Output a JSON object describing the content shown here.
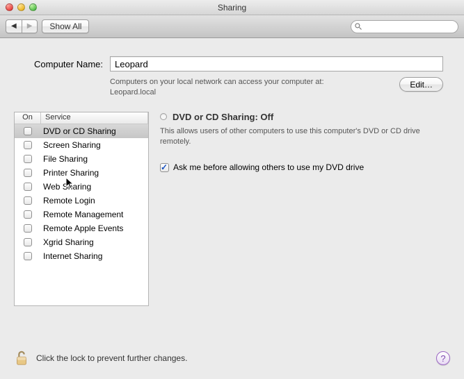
{
  "window": {
    "title": "Sharing"
  },
  "toolbar": {
    "showall_label": "Show All",
    "search_placeholder": ""
  },
  "computer_name": {
    "label": "Computer Name:",
    "value": "Leopard",
    "access_text_1": "Computers on your local network can access your computer at:",
    "access_host": "Leopard.local",
    "edit_label": "Edit…"
  },
  "services": {
    "header_on": "On",
    "header_service": "Service",
    "items": [
      {
        "name": "DVD or CD Sharing",
        "on": false,
        "selected": true
      },
      {
        "name": "Screen Sharing",
        "on": false,
        "selected": false
      },
      {
        "name": "File Sharing",
        "on": false,
        "selected": false
      },
      {
        "name": "Printer Sharing",
        "on": false,
        "selected": false
      },
      {
        "name": "Web Sharing",
        "on": false,
        "selected": false
      },
      {
        "name": "Remote Login",
        "on": false,
        "selected": false
      },
      {
        "name": "Remote Management",
        "on": false,
        "selected": false
      },
      {
        "name": "Remote Apple Events",
        "on": false,
        "selected": false
      },
      {
        "name": "Xgrid Sharing",
        "on": false,
        "selected": false
      },
      {
        "name": "Internet Sharing",
        "on": false,
        "selected": false
      }
    ]
  },
  "detail": {
    "title": "DVD or CD Sharing: Off",
    "description": "This allows users of other computers to use this computer's DVD or CD drive remotely.",
    "ask_checked": true,
    "ask_label": "Ask me before allowing others to use my DVD drive"
  },
  "footer": {
    "lock_text": "Click the lock to prevent further changes."
  }
}
